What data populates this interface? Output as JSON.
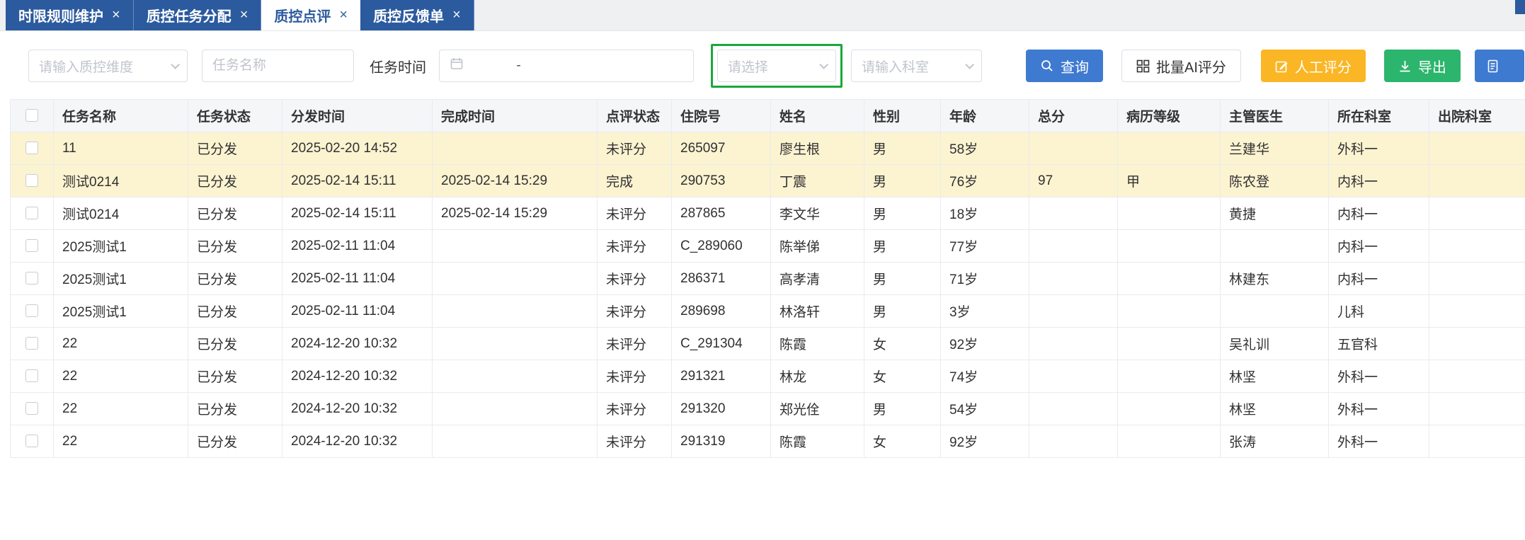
{
  "tabs": [
    {
      "label": "时限规则维护",
      "active": false
    },
    {
      "label": "质控任务分配",
      "active": false
    },
    {
      "label": "质控点评",
      "active": true
    },
    {
      "label": "质控反馈单",
      "active": false
    }
  ],
  "filters": {
    "dimension_placeholder": "请输入质控维度",
    "task_name_placeholder": "任务名称",
    "task_time_label": "任务时间",
    "date_separator": "-",
    "review_select_placeholder": "请选择",
    "dept_placeholder": "请输入科室"
  },
  "buttons": {
    "query": "查询",
    "batch_ai": "批量AI评分",
    "manual": "人工评分",
    "export": "导出"
  },
  "icons": {
    "query": "search-icon",
    "batch_ai": "grid-icon",
    "manual": "edit-icon",
    "export": "download-icon",
    "date": "calendar-icon",
    "selects": "chevron-down-icon"
  },
  "colors": {
    "tab_blue": "#2b5a9e",
    "primary_blue": "#3f7ad1",
    "warning_orange": "#fbb625",
    "success_green": "#2cb56d",
    "annotation_green": "#1aa83a",
    "row_highlight": "#fcf3d0"
  },
  "table": {
    "columns": [
      "任务名称",
      "任务状态",
      "分发时间",
      "完成时间",
      "点评状态",
      "住院号",
      "姓名",
      "性别",
      "年龄",
      "总分",
      "病历等级",
      "主管医生",
      "所在科室",
      "出院科室"
    ],
    "rows": [
      {
        "highlight": true,
        "cells": [
          "11",
          "已分发",
          "2025-02-20 14:52",
          "",
          "未评分",
          "265097",
          "廖生根",
          "男",
          "58岁",
          "",
          "",
          "兰建华",
          "外科一",
          ""
        ]
      },
      {
        "highlight": true,
        "cells": [
          "测试0214",
          "已分发",
          "2025-02-14 15:11",
          "2025-02-14 15:29",
          "完成",
          "290753",
          "丁震",
          "男",
          "76岁",
          "97",
          "甲",
          "陈农登",
          "内科一",
          ""
        ]
      },
      {
        "highlight": false,
        "cells": [
          "测试0214",
          "已分发",
          "2025-02-14 15:11",
          "2025-02-14 15:29",
          "未评分",
          "287865",
          "李文华",
          "男",
          "18岁",
          "",
          "",
          "黄捷",
          "内科一",
          ""
        ]
      },
      {
        "highlight": false,
        "cells": [
          "2025测试1",
          "已分发",
          "2025-02-11 11:04",
          "",
          "未评分",
          "C_289060",
          "陈举俤",
          "男",
          "77岁",
          "",
          "",
          "",
          "内科一",
          ""
        ]
      },
      {
        "highlight": false,
        "cells": [
          "2025测试1",
          "已分发",
          "2025-02-11 11:04",
          "",
          "未评分",
          "286371",
          "高孝清",
          "男",
          "71岁",
          "",
          "",
          "林建东",
          "内科一",
          ""
        ]
      },
      {
        "highlight": false,
        "cells": [
          "2025测试1",
          "已分发",
          "2025-02-11 11:04",
          "",
          "未评分",
          "289698",
          "林洛轩",
          "男",
          "3岁",
          "",
          "",
          "",
          "儿科",
          ""
        ]
      },
      {
        "highlight": false,
        "cells": [
          "22",
          "已分发",
          "2024-12-20 10:32",
          "",
          "未评分",
          "C_291304",
          "陈霞",
          "女",
          "92岁",
          "",
          "",
          "吴礼训",
          "五官科",
          ""
        ]
      },
      {
        "highlight": false,
        "cells": [
          "22",
          "已分发",
          "2024-12-20 10:32",
          "",
          "未评分",
          "291321",
          "林龙",
          "女",
          "74岁",
          "",
          "",
          "林坚",
          "外科一",
          ""
        ]
      },
      {
        "highlight": false,
        "cells": [
          "22",
          "已分发",
          "2024-12-20 10:32",
          "",
          "未评分",
          "291320",
          "郑光佺",
          "男",
          "54岁",
          "",
          "",
          "林坚",
          "外科一",
          ""
        ]
      },
      {
        "highlight": false,
        "cells": [
          "22",
          "已分发",
          "2024-12-20 10:32",
          "",
          "未评分",
          "291319",
          "陈霞",
          "女",
          "92岁",
          "",
          "",
          "张涛",
          "外科一",
          ""
        ]
      }
    ]
  }
}
